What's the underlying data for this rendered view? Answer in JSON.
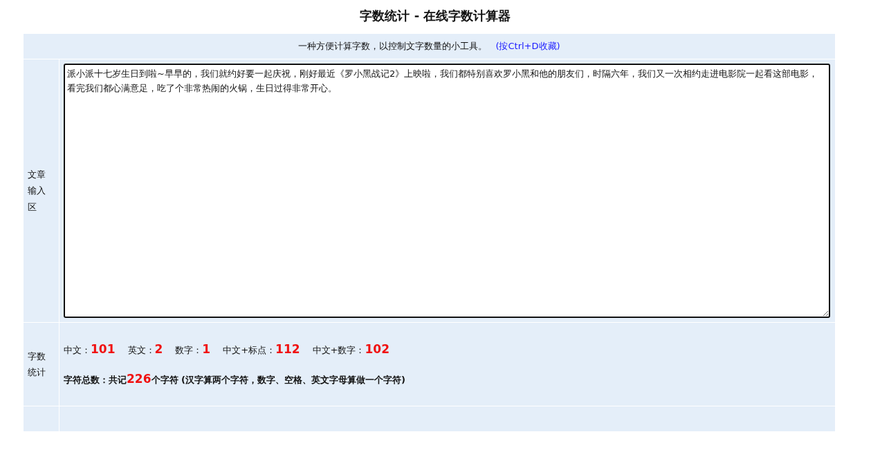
{
  "title": "字数统计 - 在线字数计算器",
  "intro": {
    "text": "一种方便计算字数，以控制文字数量的小工具。",
    "link": "(按Ctrl+D收藏)"
  },
  "input": {
    "label": "文章输入区",
    "value": "派小派十七岁生日到啦~早早的，我们就约好要一起庆祝，刚好最近《罗小黑战记2》上映啦，我们都特别喜欢罗小黑和他的朋友们，时隔六年，我们又一次相约走进电影院一起看这部电影，看完我们都心满意足，吃了个非常热闹的火锅，生日过得非常开心。"
  },
  "stats": {
    "label": "字数统计",
    "counts": [
      {
        "label": "中文：",
        "value": "101"
      },
      {
        "label": "英文：",
        "value": "2"
      },
      {
        "label": "数字：",
        "value": "1"
      },
      {
        "label": "中文+标点：",
        "value": "112"
      },
      {
        "label": "中文+数字：",
        "value": "102"
      }
    ],
    "total": {
      "prefix": "字符总数：共记",
      "value": "226",
      "suffix": "个字符 (汉字算两个字符，数字、空格、英文字母算做一个字符)"
    }
  }
}
